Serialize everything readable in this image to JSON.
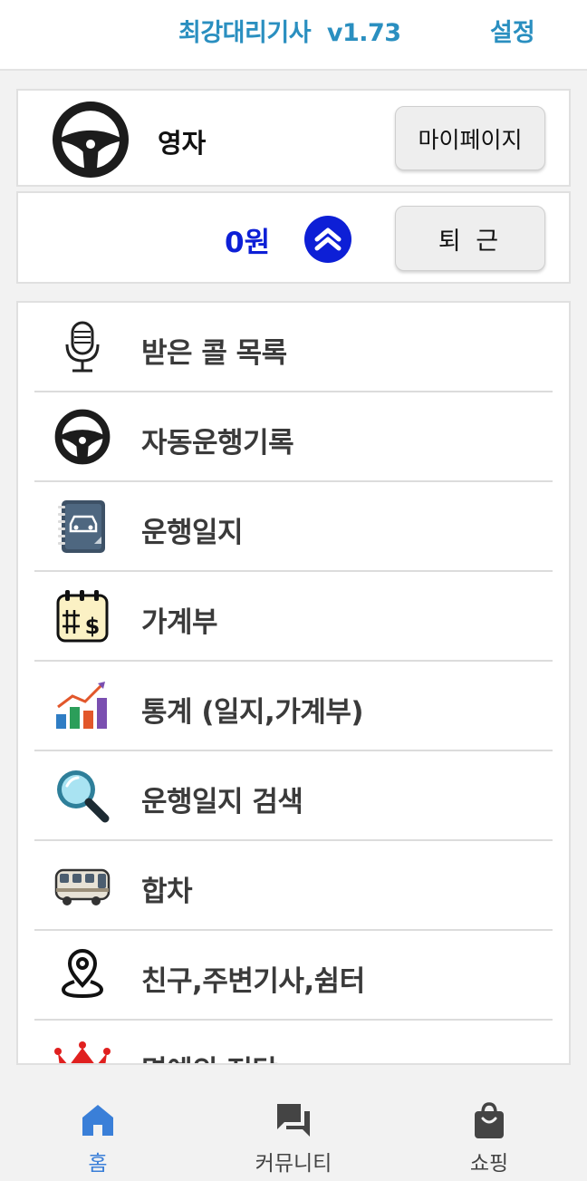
{
  "header": {
    "title": "최강대리기사  v1.73",
    "settings_label": "설정"
  },
  "profile": {
    "name": "영자",
    "mypage_label": "마이페이지"
  },
  "earnings": {
    "amount": "0원",
    "offwork_label": "퇴 근"
  },
  "menu": {
    "items": [
      {
        "label": "받은 콜 목록",
        "icon": "microphone-icon"
      },
      {
        "label": "자동운행기록",
        "icon": "steering-wheel-icon"
      },
      {
        "label": "운행일지",
        "icon": "car-notebook-icon"
      },
      {
        "label": "가계부",
        "icon": "calendar-dollar-icon"
      },
      {
        "label": "통계 (일지,가계부)",
        "icon": "bar-chart-icon"
      },
      {
        "label": "운행일지 검색",
        "icon": "magnifier-icon"
      },
      {
        "label": "합차",
        "icon": "bus-icon"
      },
      {
        "label": "친구,주변기사,쉼터",
        "icon": "location-pin-icon"
      },
      {
        "label": "명예의 전당",
        "icon": "crown-icon"
      }
    ]
  },
  "nav": {
    "home_label": "홈",
    "community_label": "커뮤니티",
    "shopping_label": "쇼핑"
  },
  "colors": {
    "accent": "#2a8fc0",
    "earnings": "#0d1fd6",
    "nav_active": "#3a7fd8"
  }
}
